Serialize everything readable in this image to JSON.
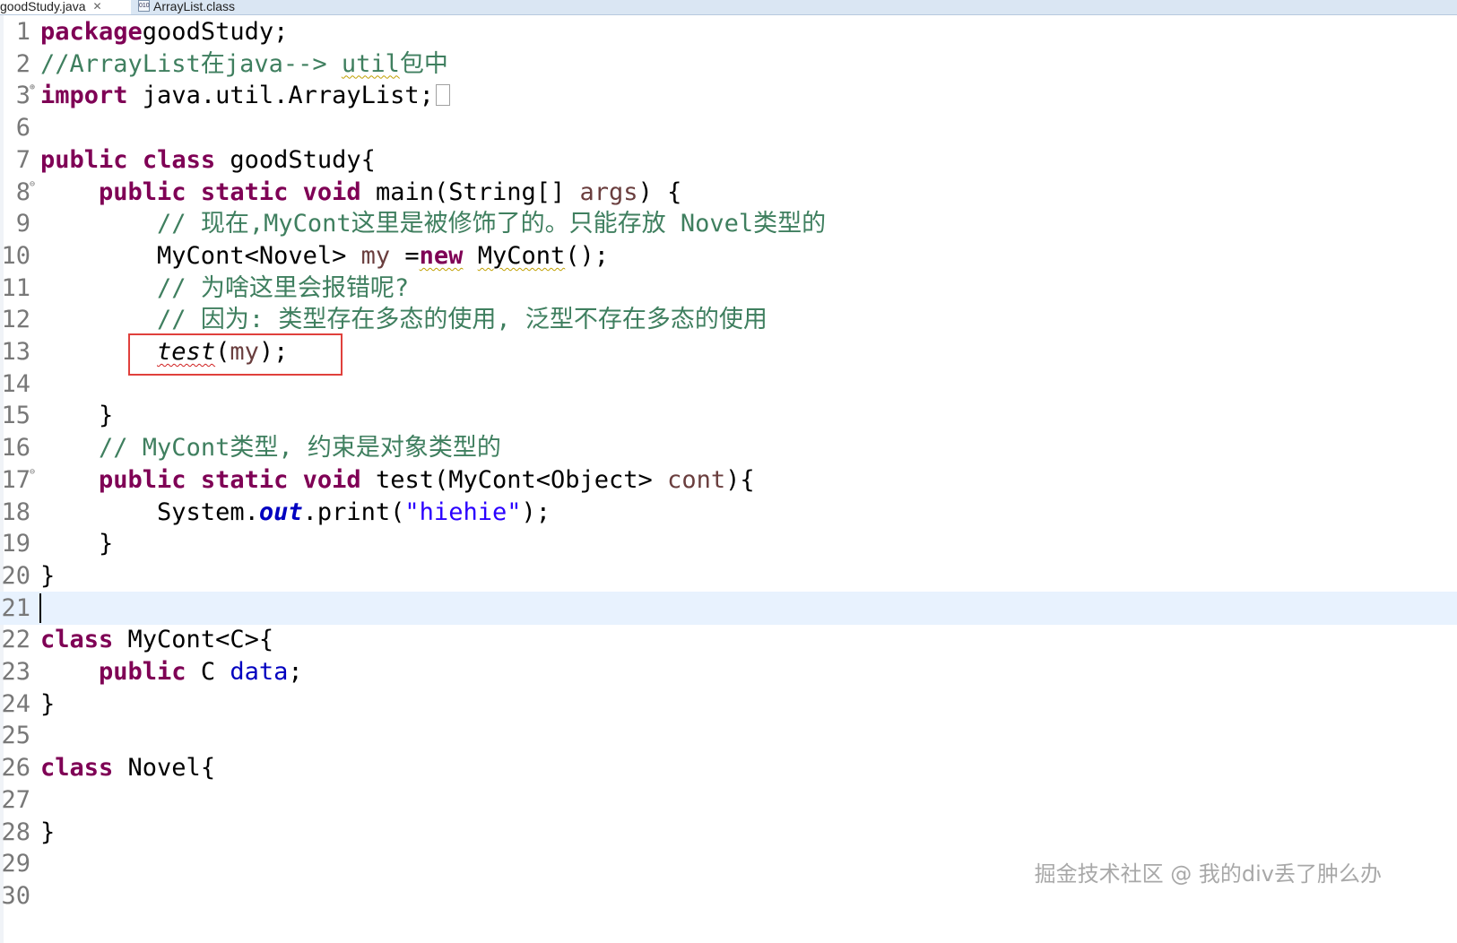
{
  "tabs": [
    {
      "label": "goodStudy.java",
      "active": true,
      "close": "✕"
    },
    {
      "label": "ArrayList.class",
      "active": false,
      "icon": "class-file-icon",
      "icon_text": "010"
    }
  ],
  "lines": [
    {
      "num": "1",
      "fold": "",
      "tokens": [
        [
          "kw",
          "package"
        ],
        [
          "",
          "goodStudy;"
        ]
      ]
    },
    {
      "num": "2",
      "fold": "",
      "tokens": [
        [
          "cm",
          "//ArrayList在java--> "
        ],
        [
          "cm squig",
          "util"
        ],
        [
          "cm",
          "包中"
        ]
      ]
    },
    {
      "num": "3",
      "fold": "⊕",
      "tokens": [
        [
          "kw",
          "import"
        ],
        [
          "",
          " java.util.ArrayList;"
        ]
      ],
      "collapsed": true
    },
    {
      "num": "6",
      "fold": "",
      "tokens": []
    },
    {
      "num": "7",
      "fold": "",
      "tokens": [
        [
          "kw",
          "public"
        ],
        [
          "",
          " "
        ],
        [
          "kw",
          "class"
        ],
        [
          "",
          " goodStudy{"
        ]
      ]
    },
    {
      "num": "8",
      "fold": "⊖",
      "tokens": [
        [
          "",
          "    "
        ],
        [
          "kw",
          "public"
        ],
        [
          "",
          " "
        ],
        [
          "kw",
          "static"
        ],
        [
          "",
          " "
        ],
        [
          "kw",
          "void"
        ],
        [
          "",
          " main(String[] "
        ],
        [
          "var",
          "args"
        ],
        [
          "",
          ") {"
        ]
      ]
    },
    {
      "num": "9",
      "fold": "",
      "tokens": [
        [
          "",
          "        "
        ],
        [
          "cm",
          "// 现在,MyCont这里是被修饰了的。只能存放 Novel类型的"
        ]
      ]
    },
    {
      "num": "10",
      "fold": "",
      "tokens": [
        [
          "",
          "        MyCont<Novel> "
        ],
        [
          "var",
          "my"
        ],
        [
          "",
          " ="
        ],
        [
          "kw squig",
          "new"
        ],
        [
          "",
          " "
        ],
        [
          "squig",
          "MyCont"
        ],
        [
          "",
          "();"
        ]
      ]
    },
    {
      "num": "11",
      "fold": "",
      "tokens": [
        [
          "",
          "        "
        ],
        [
          "cm",
          "// 为啥这里会报错呢?"
        ]
      ]
    },
    {
      "num": "12",
      "fold": "",
      "tokens": [
        [
          "",
          "        "
        ],
        [
          "cm",
          "// 因为: 类型存在多态的使用, 泛型不存在多态的使用"
        ]
      ]
    },
    {
      "num": "13",
      "fold": "",
      "tokens": [
        [
          "",
          "        "
        ],
        [
          "it squig-red",
          "test"
        ],
        [
          "",
          "("
        ],
        [
          "var",
          "my"
        ],
        [
          "",
          ");"
        ]
      ]
    },
    {
      "num": "14",
      "fold": "",
      "tokens": []
    },
    {
      "num": "15",
      "fold": "",
      "tokens": [
        [
          "",
          "    }"
        ]
      ]
    },
    {
      "num": "16",
      "fold": "",
      "tokens": [
        [
          "",
          "    "
        ],
        [
          "cm",
          "// MyCont类型, 约束是对象类型的"
        ]
      ]
    },
    {
      "num": "17",
      "fold": "⊖",
      "tokens": [
        [
          "",
          "    "
        ],
        [
          "kw",
          "public"
        ],
        [
          "",
          " "
        ],
        [
          "kw",
          "static"
        ],
        [
          "",
          " "
        ],
        [
          "kw",
          "void"
        ],
        [
          "",
          " test(MyCont<Object> "
        ],
        [
          "var",
          "cont"
        ],
        [
          "",
          "){"
        ]
      ]
    },
    {
      "num": "18",
      "fold": "",
      "tokens": [
        [
          "",
          "        System."
        ],
        [
          "sfld",
          "out"
        ],
        [
          "",
          ".print("
        ],
        [
          "str",
          "\"hiehie\""
        ],
        [
          "",
          ");"
        ]
      ]
    },
    {
      "num": "19",
      "fold": "",
      "tokens": [
        [
          "",
          "    }"
        ]
      ]
    },
    {
      "num": "20",
      "fold": "",
      "tokens": [
        [
          "",
          "}"
        ]
      ]
    },
    {
      "num": "21",
      "fold": "",
      "tokens": [],
      "current": true
    },
    {
      "num": "22",
      "fold": "",
      "tokens": [
        [
          "kw",
          "class"
        ],
        [
          "",
          " MyCont<C>{"
        ]
      ]
    },
    {
      "num": "23",
      "fold": "",
      "tokens": [
        [
          "",
          "    "
        ],
        [
          "kw",
          "public"
        ],
        [
          "",
          " C "
        ],
        [
          "fld",
          "data"
        ],
        [
          "",
          ";"
        ]
      ]
    },
    {
      "num": "24",
      "fold": "",
      "tokens": [
        [
          "",
          "}"
        ]
      ]
    },
    {
      "num": "25",
      "fold": "",
      "tokens": []
    },
    {
      "num": "26",
      "fold": "",
      "tokens": [
        [
          "kw",
          "class"
        ],
        [
          "",
          " Novel{"
        ]
      ]
    },
    {
      "num": "27",
      "fold": "",
      "tokens": []
    },
    {
      "num": "28",
      "fold": "",
      "tokens": [
        [
          "",
          "}"
        ]
      ]
    },
    {
      "num": "29",
      "fold": "",
      "tokens": []
    },
    {
      "num": "30",
      "fold": "",
      "tokens": []
    }
  ],
  "highlight_line": "13",
  "watermark": "掘金技术社区 @ 我的div丢了肿么办",
  "colors": {
    "keyword": "#7f0055",
    "comment": "#3f7f5f",
    "string": "#2a00ff",
    "field": "#0000c0",
    "local_variable": "#6a3e3e",
    "highlight_box": "#e0403c",
    "current_line": "#e8f2fe"
  }
}
